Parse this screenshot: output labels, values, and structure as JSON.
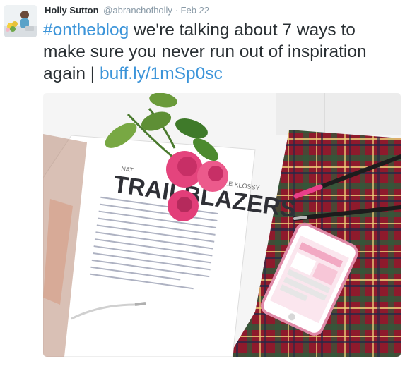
{
  "tweet": {
    "author_name": "Holly Sutton",
    "handle": "@abranchofholly",
    "separator": "·",
    "date": "Feb 22",
    "text": {
      "hashtag": "#ontheblog",
      "body": " we're talking about 7 ways to make sure you never run out of inspiration again | ",
      "link": "buff.ly/1mSp0sc"
    },
    "media": {
      "magazine_title": "TRAILBLAZERS",
      "magazine_byline_left": "NAT",
      "magazine_byline_right": "LLE KLOSSY"
    }
  },
  "colors": {
    "link": "#3b94d9",
    "name": "#292f33",
    "muted": "#8899a6",
    "tartan_red": "#8e1a2c",
    "rose_pink": "#e4447d"
  }
}
